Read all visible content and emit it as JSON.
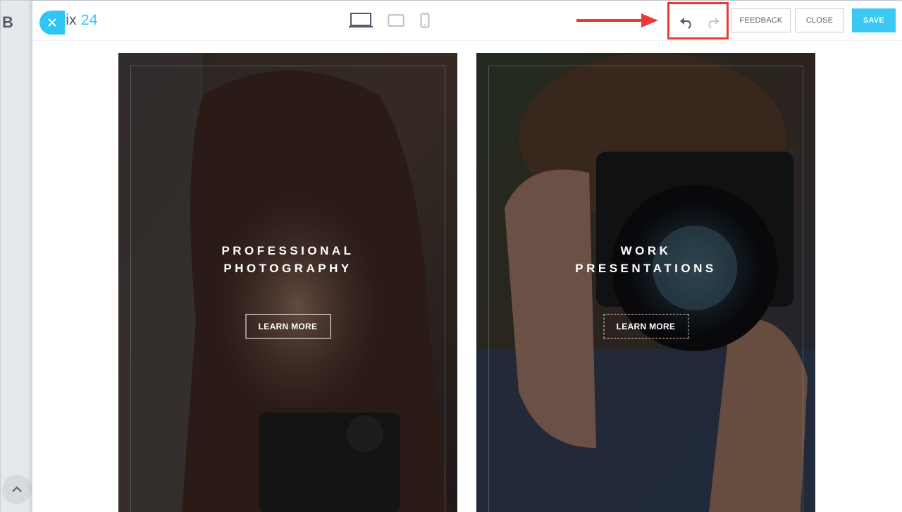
{
  "background": {
    "logo_fragment": "B"
  },
  "header": {
    "brand_name": "Bitrix",
    "brand_number": "24",
    "feedback_label": "FEEDBACK",
    "close_label": "CLOSE",
    "save_label": "SAVE",
    "devices": [
      "laptop-icon",
      "tablet-icon",
      "phone-icon"
    ],
    "history": [
      "undo-icon",
      "redo-icon"
    ]
  },
  "cards": [
    {
      "title": "PROFESSIONAL\nPHOTOGRAPHY",
      "button": "LEARN MORE"
    },
    {
      "title": "WORK\nPRESENTATIONS",
      "button": "LEARN MORE"
    }
  ],
  "colors": {
    "accent": "#2fc6f6",
    "highlight": "#ea3a3a",
    "text": "#535c69"
  }
}
